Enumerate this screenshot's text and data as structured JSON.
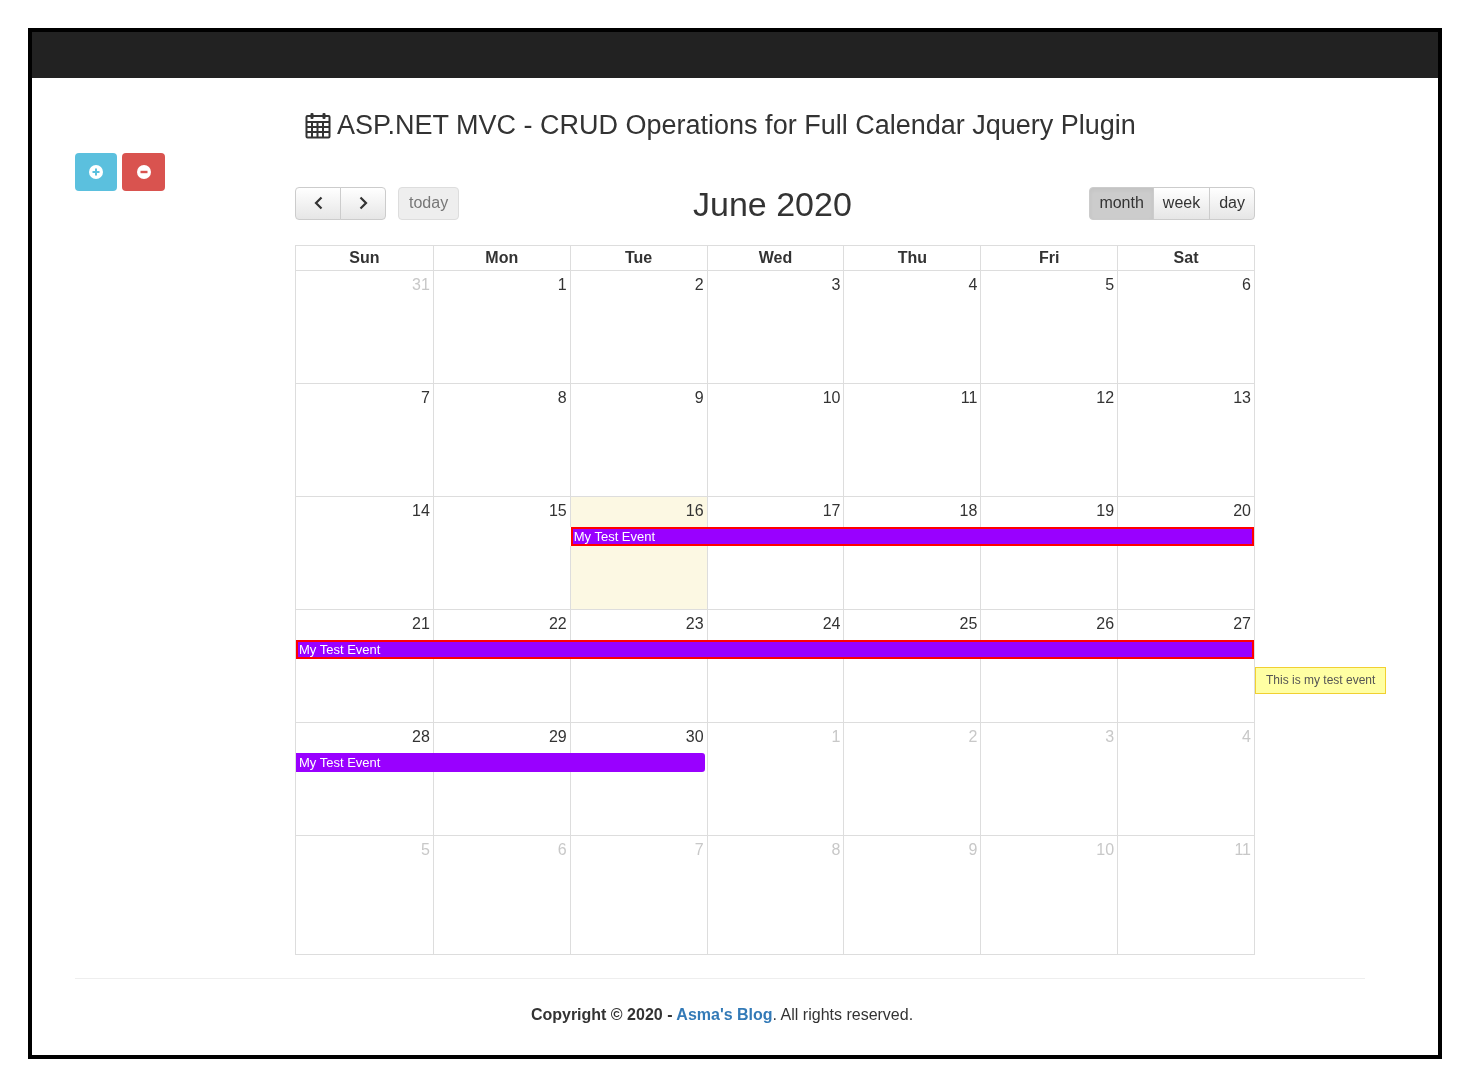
{
  "page_title": "ASP.NET MVC - CRUD Operations for Full Calendar Jquery Plugin",
  "action_buttons": [
    {
      "kind": "add"
    },
    {
      "kind": "remove"
    }
  ],
  "toolbar": {
    "nav": [
      {
        "kind": "prev"
      },
      {
        "kind": "next"
      }
    ],
    "today": {
      "label": "today",
      "disabled": true
    },
    "title": "June 2020",
    "views": [
      {
        "label": "month",
        "selected": true
      },
      {
        "label": "week",
        "selected": false
      },
      {
        "label": "day",
        "selected": false
      }
    ]
  },
  "calendar": {
    "weekdays": [
      "Sun",
      "Mon",
      "Tue",
      "Wed",
      "Thu",
      "Fri",
      "Sat"
    ],
    "weeks": [
      {
        "days": [
          {
            "day": "31",
            "other_month": true,
            "today": false
          },
          {
            "day": "1",
            "other_month": false,
            "today": false
          },
          {
            "day": "2",
            "other_month": false,
            "today": false
          },
          {
            "day": "3",
            "other_month": false,
            "today": false
          },
          {
            "day": "4",
            "other_month": false,
            "today": false
          },
          {
            "day": "5",
            "other_month": false,
            "today": false
          },
          {
            "day": "6",
            "other_month": false,
            "today": false
          }
        ]
      },
      {
        "days": [
          {
            "day": "7",
            "other_month": false,
            "today": false
          },
          {
            "day": "8",
            "other_month": false,
            "today": false
          },
          {
            "day": "9",
            "other_month": false,
            "today": false
          },
          {
            "day": "10",
            "other_month": false,
            "today": false
          },
          {
            "day": "11",
            "other_month": false,
            "today": false
          },
          {
            "day": "12",
            "other_month": false,
            "today": false
          },
          {
            "day": "13",
            "other_month": false,
            "today": false
          }
        ]
      },
      {
        "days": [
          {
            "day": "14",
            "other_month": false,
            "today": false,
            "in_event": false
          },
          {
            "day": "15",
            "other_month": false,
            "today": false,
            "in_event": false
          },
          {
            "day": "16",
            "other_month": false,
            "today": true,
            "in_event": true
          },
          {
            "day": "17",
            "other_month": false,
            "today": false,
            "in_event": true
          },
          {
            "day": "18",
            "other_month": false,
            "today": false,
            "in_event": true
          },
          {
            "day": "19",
            "other_month": false,
            "today": false,
            "in_event": true
          },
          {
            "day": "20",
            "other_month": false,
            "today": false,
            "in_event": true
          }
        ],
        "event": {
          "title": "My Test Event",
          "highlighted": true
        }
      },
      {
        "days": [
          {
            "day": "21",
            "other_month": false,
            "today": false,
            "in_event": true
          },
          {
            "day": "22",
            "other_month": false,
            "today": false,
            "in_event": true
          },
          {
            "day": "23",
            "other_month": false,
            "today": false,
            "in_event": true
          },
          {
            "day": "24",
            "other_month": false,
            "today": false,
            "in_event": true
          },
          {
            "day": "25",
            "other_month": false,
            "today": false,
            "in_event": true
          },
          {
            "day": "26",
            "other_month": false,
            "today": false,
            "in_event": true
          },
          {
            "day": "27",
            "other_month": false,
            "today": false,
            "in_event": true
          }
        ],
        "event": {
          "title": "My Test Event",
          "highlighted": true
        },
        "tooltip": "This is my test event"
      },
      {
        "days": [
          {
            "day": "28",
            "other_month": false,
            "today": false,
            "in_event": true
          },
          {
            "day": "29",
            "other_month": false,
            "today": false,
            "in_event": true
          },
          {
            "day": "30",
            "other_month": false,
            "today": false,
            "in_event": true
          },
          {
            "day": "1",
            "other_month": true,
            "today": false,
            "in_event": false
          },
          {
            "day": "2",
            "other_month": true,
            "today": false,
            "in_event": false
          },
          {
            "day": "3",
            "other_month": true,
            "today": false,
            "in_event": false
          },
          {
            "day": "4",
            "other_month": true,
            "today": false,
            "in_event": false
          }
        ],
        "event": {
          "title": "My Test Event",
          "highlighted": false
        }
      },
      {
        "days": [
          {
            "day": "5",
            "other_month": true,
            "today": false
          },
          {
            "day": "6",
            "other_month": true,
            "today": false
          },
          {
            "day": "7",
            "other_month": true,
            "today": false
          },
          {
            "day": "8",
            "other_month": true,
            "today": false
          },
          {
            "day": "9",
            "other_month": true,
            "today": false
          },
          {
            "day": "10",
            "other_month": true,
            "today": false
          },
          {
            "day": "11",
            "other_month": true,
            "today": false
          }
        ]
      }
    ]
  },
  "footer": {
    "copyright": "Copyright © 2020 - ",
    "link": "Asma's Blog",
    "rest": ". All rights reserved."
  }
}
